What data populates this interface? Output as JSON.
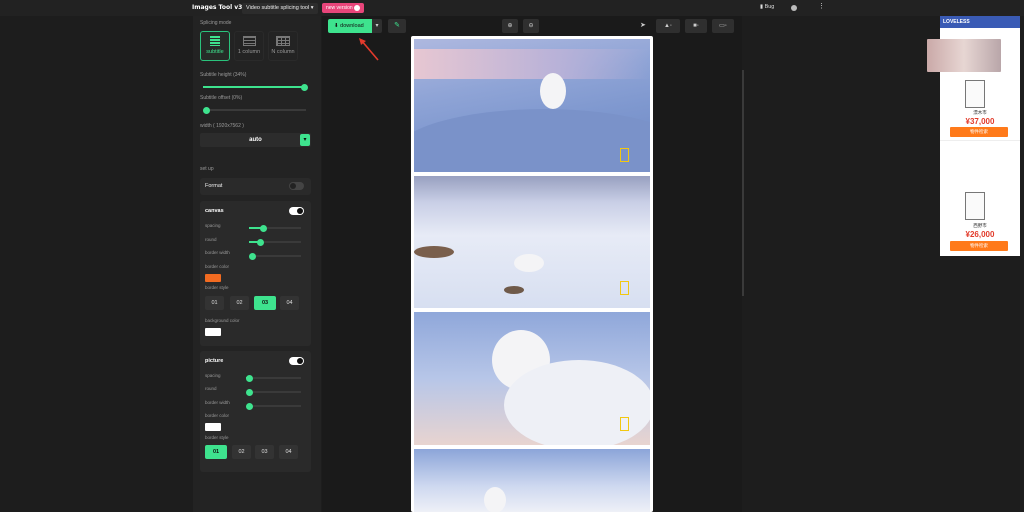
{
  "app": {
    "title": "Images Tool v3.0",
    "tool_selector": "Video subtitle splicing tool",
    "new_version": "new version",
    "bug": "Bug"
  },
  "sidebar": {
    "splicing_mode_label": "Splicing mode",
    "modes": [
      {
        "label": "subtitle",
        "active": true
      },
      {
        "label": "1 column",
        "active": false
      },
      {
        "label": "N column",
        "active": false
      }
    ],
    "subtitle_height_label": "Subtitle height (34%)",
    "subtitle_height_value": 0.99,
    "subtitle_offset_label": "Subtitle offset (0%)",
    "subtitle_offset_value": 0,
    "width_label": "width ( 1920x7562 )",
    "width_value": "auto",
    "setup_label": "set up",
    "format_label": "Format",
    "canvas": {
      "title": "canvas",
      "enabled": true,
      "spacing_label": "spacing",
      "round_label": "round",
      "border_width_label": "border width",
      "border_color_label": "border color",
      "border_color": "#f26b21",
      "border_style_label": "border style",
      "styles": [
        "01",
        "02",
        "03",
        "04"
      ],
      "active_style": "03",
      "background_color_label": "background color",
      "background_color": "#ffffff"
    },
    "picture": {
      "title": "picture",
      "enabled": true,
      "spacing_label": "spacing",
      "round_label": "round",
      "border_width_label": "border width",
      "border_color_label": "border color",
      "border_color": "#ffffff",
      "border_style_label": "border style",
      "styles": [
        "01",
        "02",
        "03",
        "04"
      ],
      "active_style": "01"
    }
  },
  "toolbar": {
    "download": "download",
    "zoom_in": "zoom-in-icon",
    "zoom_out": "zoom-out-icon"
  },
  "ad": {
    "title": "LOVELESS",
    "price1": "¥37,000",
    "name1": "漂木市",
    "btn1": "物件检索",
    "price2": "¥26,000",
    "name2": "西野市",
    "btn2": "物件检索"
  },
  "colors": {
    "accent": "#3ee38e",
    "background": "#1d1d1d",
    "panel": "#232323",
    "new_version": "#e8457a",
    "ad_button": "#ff7a1a"
  }
}
